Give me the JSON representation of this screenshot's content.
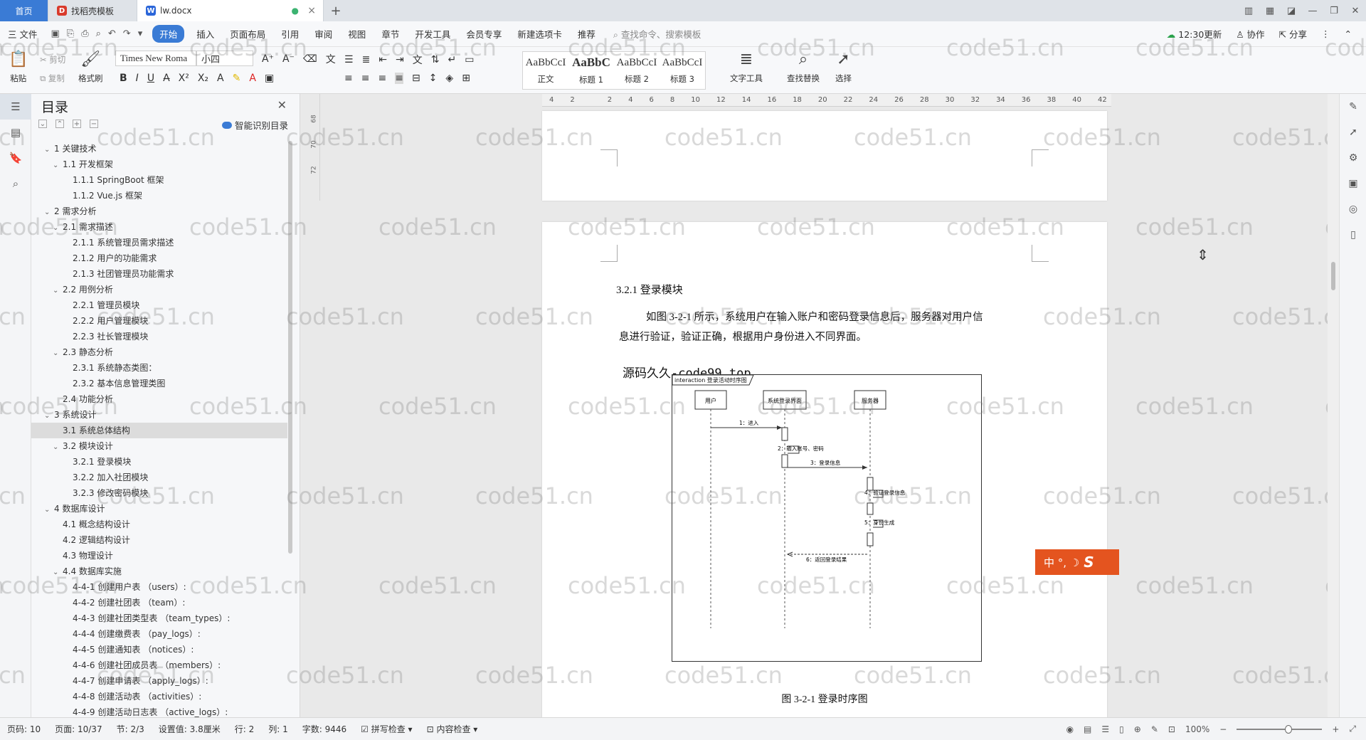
{
  "tabs": {
    "home": "首页",
    "t1": "找稻壳模板",
    "t2": "lw.docx",
    "new": "+"
  },
  "menu": {
    "file": "三 文件",
    "items": [
      "开始",
      "插入",
      "页面布局",
      "引用",
      "审阅",
      "视图",
      "章节",
      "开发工具",
      "会员专享",
      "新建选项卡",
      "推荐"
    ],
    "search": "查找命令、搜索模板",
    "update": "12:30更新",
    "collab": "协作",
    "share": "分享"
  },
  "ribbon": {
    "paste": "粘贴",
    "cut": "剪切",
    "copy": "复制",
    "format_painter": "格式刷",
    "font_name": "Times New Roma",
    "font_size": "小四",
    "styles": [
      {
        "preview": "AaBbCcI",
        "label": "正文"
      },
      {
        "preview": "AaBbC",
        "label": "标题 1"
      },
      {
        "preview": "AaBbCcI",
        "label": "标题 2"
      },
      {
        "preview": "AaBbCcI",
        "label": "标题 3"
      }
    ],
    "text_tools": "文字工具",
    "find_replace": "查找替换",
    "select": "选择"
  },
  "toc": {
    "title": "目录",
    "smart": "智能识别目录",
    "items": [
      {
        "level": 1,
        "text": "1 关键技术",
        "caret": true
      },
      {
        "level": 2,
        "text": "1.1 开发框架",
        "caret": true
      },
      {
        "level": 3,
        "text": "1.1.1 SpringBoot 框架"
      },
      {
        "level": 3,
        "text": "1.1.2 Vue.js 框架"
      },
      {
        "level": 1,
        "text": "2 需求分析",
        "caret": true
      },
      {
        "level": 2,
        "text": "2.1 需求描述",
        "caret": true
      },
      {
        "level": 3,
        "text": "2.1.1 系统管理员需求描述"
      },
      {
        "level": 3,
        "text": "2.1.2 用户的功能需求"
      },
      {
        "level": 3,
        "text": "2.1.3 社团管理员功能需求"
      },
      {
        "level": 2,
        "text": "2.2 用例分析",
        "caret": true
      },
      {
        "level": 3,
        "text": "2.2.1 管理员模块"
      },
      {
        "level": 3,
        "text": "2.2.2 用户管理模块"
      },
      {
        "level": 3,
        "text": "2.2.3 社长管理模块"
      },
      {
        "level": 2,
        "text": "2.3 静态分析",
        "caret": true
      },
      {
        "level": 3,
        "text": "2.3.1 系统静态类图："
      },
      {
        "level": 3,
        "text": "2.3.2 基本信息管理类图"
      },
      {
        "level": 2,
        "text": "2.4 功能分析"
      },
      {
        "level": 1,
        "text": "3 系统设计",
        "caret": true
      },
      {
        "level": 2,
        "text": "3.1 系统总体结构",
        "selected": true
      },
      {
        "level": 2,
        "text": "3.2 模块设计",
        "caret": true
      },
      {
        "level": 3,
        "text": "3.2.1 登录模块"
      },
      {
        "level": 3,
        "text": "3.2.2 加入社团模块"
      },
      {
        "level": 3,
        "text": "3.2.3 修改密码模块"
      },
      {
        "level": 1,
        "text": "4 数据库设计",
        "caret": true
      },
      {
        "level": 2,
        "text": "4.1 概念结构设计"
      },
      {
        "level": 2,
        "text": "4.2 逻辑结构设计"
      },
      {
        "level": 2,
        "text": "4.3 物理设计"
      },
      {
        "level": 2,
        "text": "4.4 数据库实施",
        "caret": true
      },
      {
        "level": 3,
        "text": "4-4-1 创建用户表 （users）:"
      },
      {
        "level": 3,
        "text": "4-4-2 创建社团表 （team）:"
      },
      {
        "level": 3,
        "text": "4-4-3 创建社团类型表 （team_types）:"
      },
      {
        "level": 3,
        "text": "4-4-4 创建缴费表 （pay_logs）:"
      },
      {
        "level": 3,
        "text": "4-4-5 创建通知表 （notices）:"
      },
      {
        "level": 3,
        "text": "4-4-6 创建社团成员表 （members）:"
      },
      {
        "level": 3,
        "text": "4-4-7 创建申请表 （apply_logs）:"
      },
      {
        "level": 3,
        "text": "4-4-8 创建活动表 （activities）:"
      },
      {
        "level": 3,
        "text": "4-4-9 创建活动日志表 （active_logs）:"
      }
    ]
  },
  "ruler": {
    "h": [
      "4",
      "2",
      "",
      "2",
      "4",
      "6",
      "8",
      "10",
      "12",
      "14",
      "16",
      "18",
      "20",
      "22",
      "24",
      "26",
      "28",
      "30",
      "32",
      "34",
      "36",
      "38",
      "40",
      "42"
    ],
    "v": [
      "68",
      "70",
      "72"
    ]
  },
  "doc": {
    "heading": "3.2.1 登录模块",
    "para_line1": "如图 3-2-1 所示，系统用户在输入账户和密码登录信息后，服务器对用户信",
    "para_line2": "息进行验证，验证正确，根据用户身份进入不同界面。",
    "overlay": "源码久久-code99.top",
    "caption": "图 3-2-1 登录时序图",
    "diagram": {
      "frame": "interaction 登录活动时序图",
      "lifelines": [
        "用户",
        "系统登录界面",
        "服务器"
      ],
      "messages": [
        "1：进入",
        "2：输入账号、密码",
        "3：登录信息",
        "4：验证登录信息",
        "5：身份生成",
        "6：返回登录结果"
      ]
    }
  },
  "watermark": "code51.cn",
  "ime": "中 °, ☽",
  "status": {
    "page_no": "页码: 10",
    "page": "页面: 10/37",
    "section": "节: 2/3",
    "setting": "设置值: 3.8厘米",
    "row": "行: 2",
    "col": "列: 1",
    "words": "字数: 9446",
    "spell": "拼写检查",
    "content": "内容检查",
    "zoom": "100%"
  }
}
